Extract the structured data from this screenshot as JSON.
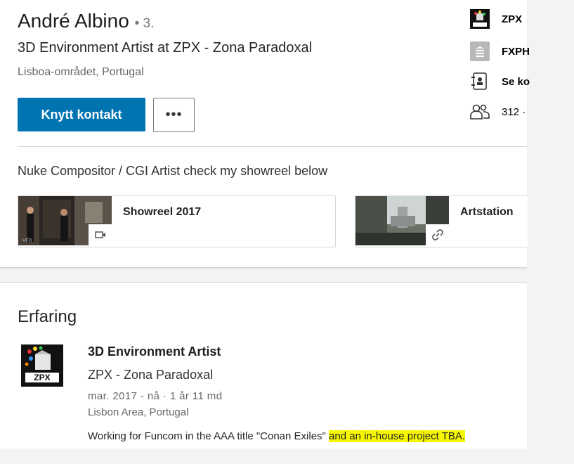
{
  "profile": {
    "name": "André Albino",
    "degree": "• 3.",
    "headline": "3D Environment Artist at ZPX - Zona Paradoxal",
    "location": "Lisboa-området, Portugal",
    "connect_label": "Knytt kontakt",
    "more_label": "•••"
  },
  "sidebar": {
    "items": [
      {
        "label": "ZPX",
        "icon": "zpx-logo-icon"
      },
      {
        "label": "FXPH",
        "icon": "school-icon"
      },
      {
        "label": "Se ko",
        "icon": "contact-card-icon"
      },
      {
        "label": "312 ·",
        "icon": "connections-icon"
      }
    ]
  },
  "summary": "Nuke Compositor / CGI Artist check my showreel below",
  "media": [
    {
      "title": "Showreel 2017",
      "badge_icon": "video-icon",
      "thumb_caption": "VFX"
    },
    {
      "title": "Artstation",
      "badge_icon": "link-icon"
    }
  ],
  "experience": {
    "heading": "Erfaring",
    "items": [
      {
        "title": "3D Environment Artist",
        "company": "ZPX - Zona Paradoxal",
        "dates": "mar. 2017 - nå · 1 år 11 md",
        "location": "Lisbon Area, Portugal",
        "description_plain": "Working for Funcom in the AAA title \"Conan Exiles\"",
        "description_highlight": "and an in-house project TBA."
      }
    ]
  },
  "colors": {
    "primary_button": "#0073b1",
    "highlight": "#f7f700",
    "page_background": "#f3f3f3"
  }
}
